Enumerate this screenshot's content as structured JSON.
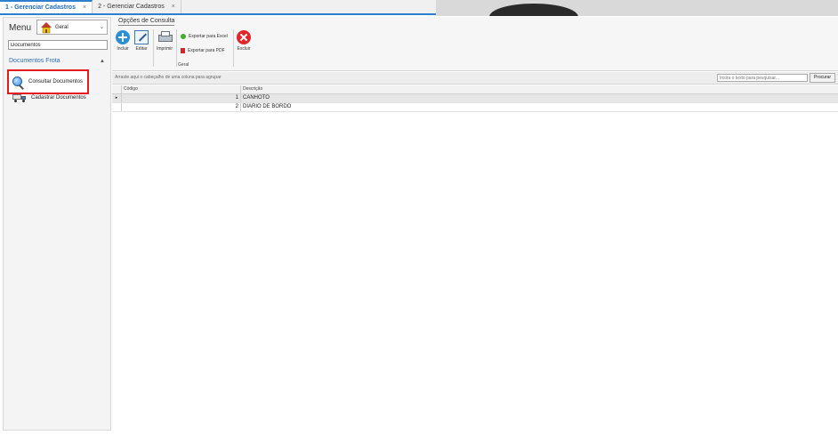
{
  "tabs": [
    {
      "label": "1 - Gerenciar Cadastros",
      "close": "×"
    },
    {
      "label": "2 - Gerenciar Cadastros",
      "close": "×"
    }
  ],
  "sidebar": {
    "menu_label": "Menu",
    "group_select": "Geral",
    "search_value": "Documentos",
    "section_title": "Documentos Frota",
    "section_collapse": "▲",
    "items": [
      {
        "label": "Consultar Documentos",
        "icon": "magnifier-icon"
      },
      {
        "label": "Cadastrar Documentos",
        "icon": "truck-icon"
      }
    ]
  },
  "ribbon": {
    "tab": "Opções de Consulta",
    "incluir": "Incluir",
    "editar": "Editar",
    "imprimir": "Imprimir",
    "exportar_excel": "Exportar para Excel",
    "exportar_pdf": "Exportar para PDF",
    "excluir": "Excluir",
    "group_label": "Geral"
  },
  "grid": {
    "group_hint": "Arraste aqui o cabeçalho de uma coluna para agrupar",
    "search_placeholder": "Insira o texto para pesquisar...",
    "find_label": "Procurar",
    "columns": [
      "Código",
      "Descrição"
    ],
    "rows": [
      {
        "indicator": "▸",
        "code": "1",
        "desc": "CANHOTO"
      },
      {
        "indicator": "",
        "code": "2",
        "desc": "DIARIO DE BORDO"
      }
    ]
  },
  "colors": {
    "accent": "#2f7fd0",
    "selection": "#e31b23",
    "delete": "#e0262a"
  }
}
